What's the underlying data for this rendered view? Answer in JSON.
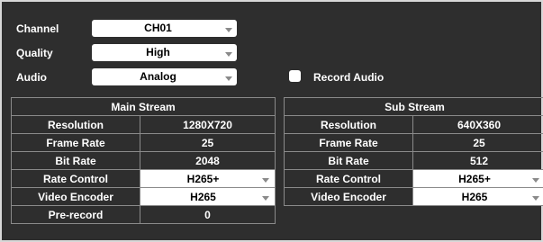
{
  "settings": {
    "channel": {
      "label": "Channel",
      "value": "CH01"
    },
    "quality": {
      "label": "Quality",
      "value": "High"
    },
    "audio": {
      "label": "Audio",
      "value": "Analog"
    },
    "record_audio": {
      "label": "Record Audio",
      "checked": false
    }
  },
  "main_stream": {
    "title": "Main Stream",
    "rows": [
      {
        "label": "Resolution",
        "value": "1280X720"
      },
      {
        "label": "Frame Rate",
        "value": "25"
      },
      {
        "label": "Bit Rate",
        "value": "2048"
      },
      {
        "label": "Rate Control",
        "value": "H265+"
      },
      {
        "label": "Video Encoder",
        "value": "H265"
      },
      {
        "label": "Pre-record",
        "value": "0"
      }
    ]
  },
  "sub_stream": {
    "title": "Sub Stream",
    "rows": [
      {
        "label": "Resolution",
        "value": "640X360"
      },
      {
        "label": "Frame Rate",
        "value": "25"
      },
      {
        "label": "Bit Rate",
        "value": "512"
      },
      {
        "label": "Rate Control",
        "value": "H265+"
      },
      {
        "label": "Video Encoder",
        "value": "H265"
      }
    ]
  }
}
